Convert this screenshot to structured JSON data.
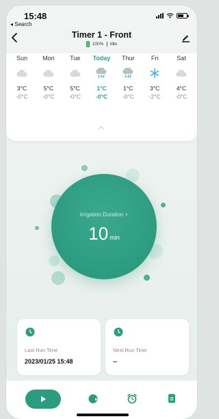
{
  "status_bar": {
    "time": "15:48",
    "back_label": "◂ Search"
  },
  "header": {
    "title": "Timer 1 - Front",
    "battery": "100%",
    "state": "Idle"
  },
  "forecast": [
    {
      "day": "Sun",
      "icon": "cloud-icon",
      "high": "3°C",
      "low": "-0°C"
    },
    {
      "day": "Mon",
      "icon": "cloud-icon",
      "high": "5°C",
      "low": "-0°C"
    },
    {
      "day": "Tue",
      "icon": "cloud-icon",
      "high": "5°C",
      "low": "-0°C"
    },
    {
      "day": "Today",
      "icon": "rain-cloud-icon",
      "high": "1°C",
      "low": "-0°C"
    },
    {
      "day": "Thur",
      "icon": "rain-cloud-icon",
      "high": "1°C",
      "low": "-0°C"
    },
    {
      "day": "Fri",
      "icon": "snowflake-icon",
      "high": "3°C",
      "low": "-2°C"
    },
    {
      "day": "Sat",
      "icon": "cloud-icon",
      "high": "4°C",
      "low": "-0°C"
    }
  ],
  "irrigation": {
    "label": "Irrigation Duration >",
    "value": "10",
    "unit": "min"
  },
  "last_run": {
    "label": "Last Run Time",
    "value": "2023/01/25 15:48"
  },
  "next_run": {
    "label": "Next Run Time",
    "value": "--"
  },
  "colors": {
    "accent": "#2a9d80",
    "today": "#28a58a",
    "snow": "#3fb6e8"
  },
  "nav_icons": [
    "play-icon",
    "water-drop-icon",
    "alarm-clock-icon",
    "document-icon"
  ]
}
